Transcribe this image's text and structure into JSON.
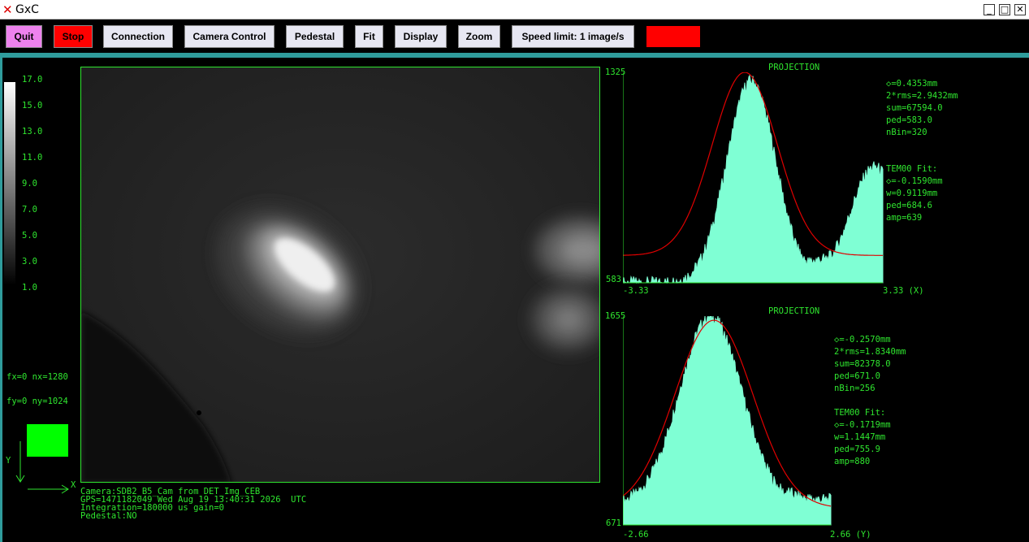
{
  "window": {
    "title": "GxC",
    "minimize": "_",
    "maximize": "□",
    "close": "✕"
  },
  "toolbar": {
    "quit": "Quit",
    "stop": "Stop",
    "connection": "Connection",
    "camera_control": "Camera Control",
    "pedestal": "Pedestal",
    "fit": "Fit",
    "display": "Display",
    "zoom": "Zoom",
    "speed_limit": "Speed limit: 1 image/s",
    "status_color": "#ff0000"
  },
  "colorscale": {
    "labels": [
      "17.0",
      "15.0",
      "13.0",
      "11.0",
      "9.0",
      "7.0",
      "5.0",
      "3.0",
      "1.0"
    ]
  },
  "info": {
    "fx": "fx=0 nx=1280",
    "fy": "fy=0 ny=1024",
    "indicator_color": "#00ff00",
    "axis_y": "Y",
    "axis_x": "X"
  },
  "camera_info": {
    "line1": "Camera:SDB2_B5_Cam from DET_Img_CEB",
    "line2": "GPS=1471182049 Wed Aug 19 13:40:31 2026  UTC",
    "line3": "Integration=180000 us gain=0",
    "line4": "Pedestal:NO"
  },
  "projection_x": {
    "title": "PROJECTION",
    "ymax": "1325",
    "ymin": "583",
    "xmin": "-3.33",
    "xmax": "3.33 (X)",
    "stats": [
      "◇=0.4353mm",
      "2*rms=2.9432mm",
      "sum=67594.0",
      "ped=583.0",
      "nBin=320"
    ],
    "fit": [
      "TEM00 Fit:",
      "◇=-0.1590mm",
      "w=0.9119mm",
      "ped=684.6",
      "amp=639"
    ]
  },
  "projection_y": {
    "title": "PROJECTION",
    "ymax": "1655",
    "ymin": "671",
    "xmin": "-2.66",
    "xmax": "2.66 (Y)",
    "stats": [
      "◇=-0.2570mm",
      "2*rms=1.8340mm",
      "sum=82378.0",
      "ped=671.0",
      "nBin=256"
    ],
    "fit": [
      "TEM00 Fit:",
      "◇=-0.1719mm",
      "w=1.1447mm",
      "ped=755.9",
      "amp=880"
    ]
  },
  "colors": {
    "accent": "#2fe62f",
    "fill": "#7fffd4",
    "fit_line": "#e00000",
    "divider": "#2f9c9c",
    "quit_bg": "#ee82ee",
    "stop_bg": "#ff0000"
  }
}
